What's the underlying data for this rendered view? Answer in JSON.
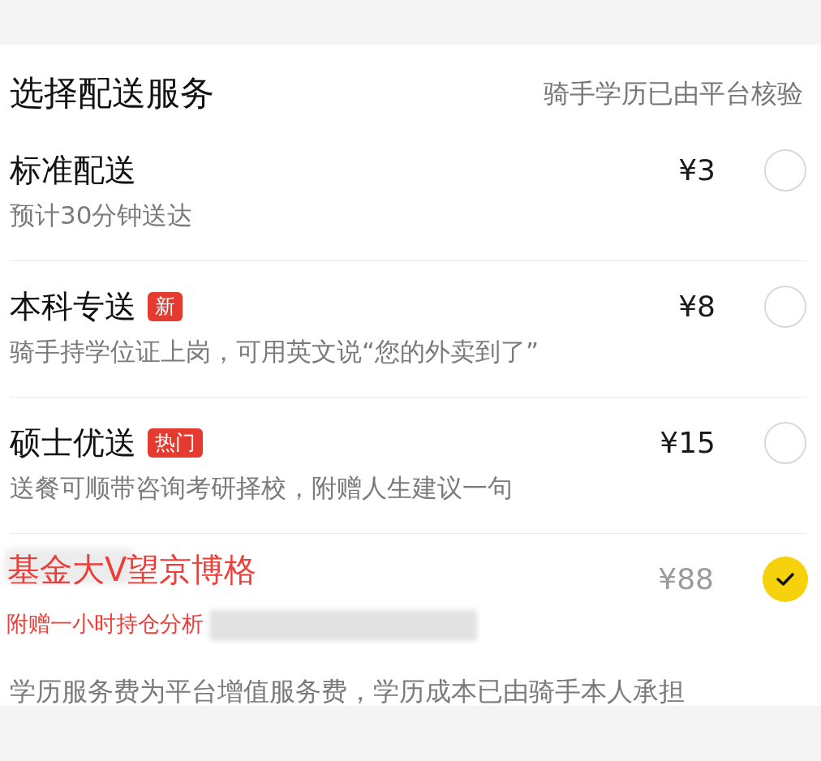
{
  "header": {
    "title": "选择配送服务",
    "note": "骑手学历已由平台核验"
  },
  "options": [
    {
      "kind": "normal",
      "title": "标准配送",
      "subtitle": "预计30分钟送达",
      "price": "¥3",
      "price_muted": false,
      "selected": false
    },
    {
      "kind": "normal",
      "title": "本科专送",
      "badge": "新",
      "subtitle": "骑手持学位证上岗，可用英文说“您的外卖到了”",
      "price": "¥8",
      "price_muted": false,
      "selected": false
    },
    {
      "kind": "normal",
      "title": "硕士优送",
      "badge": "热门",
      "subtitle": "送餐可顺带咨询考研择校，附赠人生建议一句",
      "price": "¥15",
      "price_muted": false,
      "selected": false
    },
    {
      "kind": "overlay",
      "title": "基金大V望京博格",
      "subtitle": "附赠一小时持仓分析",
      "price": "¥88",
      "price_muted": true,
      "selected": true,
      "blurred": true
    }
  ],
  "footer_note": "学历服务费为平台增值服务费，学历成本已由骑手本人承担"
}
